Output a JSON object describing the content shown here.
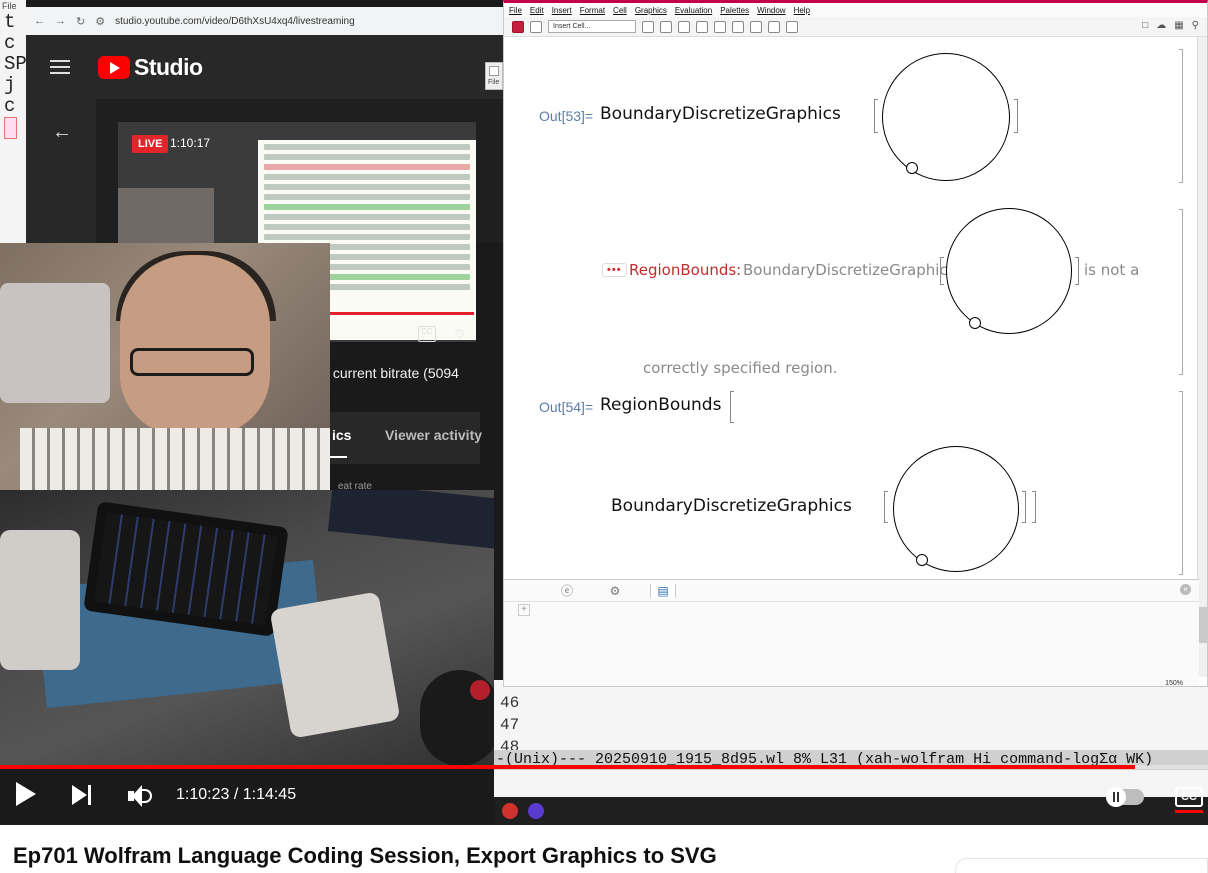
{
  "browser": {
    "url": "studio.youtube.com/video/D6thXsU4xq4/livestreaming",
    "studio_word": "Studio"
  },
  "preview": {
    "live_label": "LIVE",
    "live_time": "1:10:17",
    "bitrate_text": "s current bitrate (5094",
    "tab_partial": "ics",
    "tab_viewer": "Viewer activity",
    "heart_rate_partial": "eat rate"
  },
  "left_slice": {
    "file_label": "File",
    "chars": [
      "t",
      "c",
      "SP",
      "",
      "j",
      "c"
    ]
  },
  "mathematica": {
    "menu": [
      "File",
      "Edit",
      "Insert",
      "Format",
      "Cell",
      "Graphics",
      "Evaluation",
      "Palettes",
      "Window",
      "Help"
    ],
    "cell_style_placeholder": "Insert Cell...",
    "peek_label": "File",
    "out53": {
      "label": "Out[53]=",
      "expr": "BoundaryDiscretizeGraphics"
    },
    "message": {
      "dots": "•••",
      "head": "RegionBounds:",
      "expr": "BoundaryDiscretizeGraphics",
      "suffix": "is not a",
      "continuation": "correctly specified region."
    },
    "out54": {
      "label": "Out[54]=",
      "expr": "RegionBounds",
      "inner_expr": "BoundaryDiscretizeGraphics"
    },
    "zoom": "150%",
    "plus": "+"
  },
  "emacs": {
    "lines": [
      "46",
      "47",
      "48"
    ],
    "modeline": "-(Unix)--- 20250910_1915_8d95.wl  8%  L31   (xah-wolfram Hi command-logΣα WK)"
  },
  "player": {
    "time_display": "1:10:23 / 1:14:45",
    "progress": 0.9396,
    "cc_label": "CC"
  },
  "video_title": "Ep701 Wolfram Language Coding Session, Export Graphics to SVG",
  "colors": {
    "youtube_red": "#ff0000",
    "mma_accent": "#c4004a",
    "out_label": "#5a7fa8",
    "message_red": "#c52b2b"
  }
}
